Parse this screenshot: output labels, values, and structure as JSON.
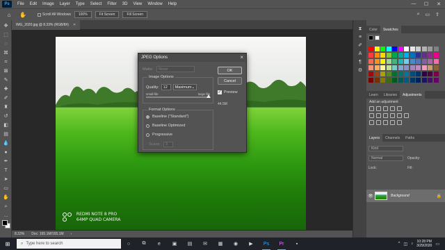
{
  "menu": {
    "logo": "Ps",
    "items": [
      "File",
      "Edit",
      "Image",
      "Layer",
      "Type",
      "Select",
      "Filter",
      "3D",
      "View",
      "Window",
      "Help"
    ],
    "window_controls": [
      "—",
      "☐",
      "✕"
    ]
  },
  "options_bar": {
    "scroll_all_label": "Scroll All Windows",
    "zoom_value": "100%",
    "fit_screen_label": "Fit Screen",
    "fill_screen_label": "Fill Screen"
  },
  "document": {
    "tab_title": "IMG_2020.jpg @ 8.33% (RGB/8#)",
    "watermark_line1": "REDMI NOTE 8 PRO",
    "watermark_line2": "64MP QUAD CAMERA"
  },
  "status_bar": {
    "zoom": "8.33%",
    "doc_size": "Doc: 165.1M/165.1M"
  },
  "dialog": {
    "title": "JPEG Options",
    "matte_label": "Matte:",
    "matte_value": "None",
    "image_options_title": "Image Options",
    "quality_label": "Quality:",
    "quality_value": "12",
    "quality_preset": "Maximum",
    "quality_fraction": 1.0,
    "small_file_label": "small file",
    "large_file_label": "large file",
    "format_options_title": "Format Options",
    "format_baseline_standard": "Baseline (\"Standard\")",
    "format_baseline_optimized": "Baseline Optimized",
    "format_progressive": "Progressive",
    "scans_label": "Scans:",
    "scans_value": "3",
    "ok_label": "OK",
    "cancel_label": "Cancel",
    "preview_label": "Preview",
    "file_size": "44.5M"
  },
  "panels": {
    "color_tabs": [
      "Color",
      "Swatches"
    ],
    "adjust_tabs": [
      "Learn",
      "Libraries",
      "Adjustments"
    ],
    "adjust_hint": "Add an adjustment",
    "layers_tabs": [
      "Layers",
      "Channels",
      "Paths"
    ],
    "kind_label": "Kind",
    "blend_mode": "Normal",
    "opacity_label": "Opacity:",
    "lock_label": "Lock:",
    "fill_label": "Fill:",
    "layer_name": "Background"
  },
  "taskbar": {
    "search_placeholder": "Type here to search",
    "time": "10:28 PM",
    "date": "3/29/2020"
  },
  "swatch_colors": [
    [
      "#ff0000",
      "#ffff00",
      "#00ff00",
      "#00ffff",
      "#0000ff",
      "#ff00ff",
      "#ffffff",
      "#e6e6e6",
      "#cccccc",
      "#b3b3b3",
      "#999999",
      "#808080"
    ],
    [
      "#ff3b3b",
      "#ff8a00",
      "#ffd800",
      "#8cc63f",
      "#00a651",
      "#00a99d",
      "#00aeef",
      "#0072bc",
      "#2e3192",
      "#662d91",
      "#92278f",
      "#ec008c"
    ],
    [
      "#f26c4f",
      "#f7941d",
      "#fff200",
      "#a3d39c",
      "#3cb878",
      "#1abbb4",
      "#6dcff6",
      "#448ccb",
      "#5674b9",
      "#8560a8",
      "#a864a8",
      "#f06eaa"
    ],
    [
      "#f69679",
      "#fbaf5d",
      "#fff799",
      "#c4df9b",
      "#7accc8",
      "#7ea7d8",
      "#8493ca",
      "#a187be",
      "#bd8cbf",
      "#f49ac1",
      "#c69c6d",
      "#8c6239"
    ],
    [
      "#9e0b0f",
      "#a0410d",
      "#aba000",
      "#598527",
      "#007236",
      "#00746b",
      "#0076a3",
      "#004a80",
      "#003471",
      "#32004b",
      "#4b0049",
      "#7b0046"
    ],
    [
      "#790000",
      "#7b2e00",
      "#827b00",
      "#406618",
      "#005826",
      "#005952",
      "#005b7f",
      "#003663",
      "#002157",
      "#1b1464",
      "#440e62",
      "#630460"
    ]
  ]
}
